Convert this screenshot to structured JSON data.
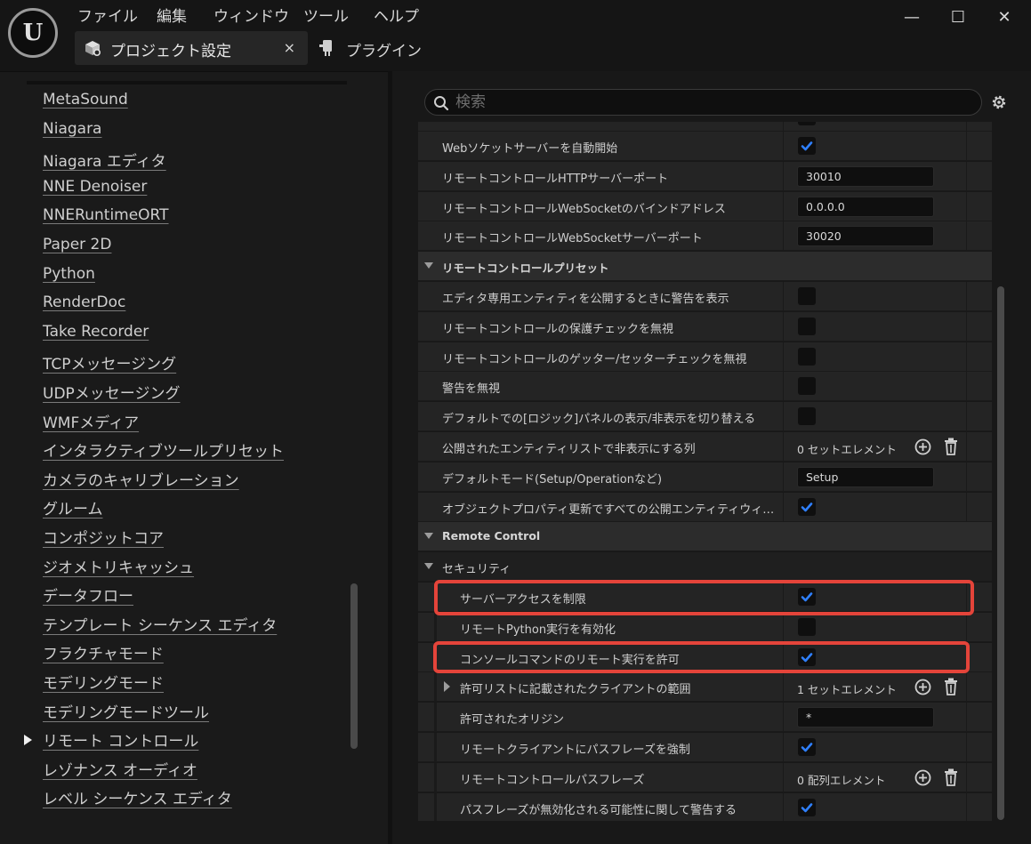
{
  "app": {
    "logo_text": "U",
    "menu": [
      "ファイル",
      "編集",
      "ウィンドウ",
      "ツール",
      "ヘルプ"
    ],
    "window_controls": {
      "minimize": "—",
      "maximize": "☐",
      "close": "✕"
    },
    "tabs": [
      {
        "label": "プロジェクト設定",
        "icon": "project-settings-icon",
        "active": true,
        "close": "×"
      },
      {
        "label": "プラグイン",
        "icon": "plugin-icon",
        "active": false
      }
    ]
  },
  "sidebar": {
    "items": [
      "MetaSound",
      "Niagara",
      "Niagara エディタ",
      "NNE Denoiser",
      "NNERuntimeORT",
      "Paper 2D",
      "Python",
      "RenderDoc",
      "Take Recorder",
      "TCPメッセージング",
      "UDPメッセージング",
      "WMFメディア",
      "インタラクティブツールプリセット",
      "カメラのキャリブレーション",
      "グルーム",
      "コンポジットコア",
      "ジオメトリキャッシュ",
      "データフロー",
      "テンプレート シーケンス エディタ",
      "フラクチャモード",
      "モデリングモード",
      "モデリングモードツール",
      "リモート コントロール",
      "レゾナンス オーディオ",
      "レベル シーケンス エディタ"
    ],
    "selected_index": 22
  },
  "search": {
    "placeholder": "検索"
  },
  "settings": {
    "rows": [
      {
        "type": "prop",
        "label": "Webソケットサーバーを自動開始",
        "value_type": "checkbox",
        "checked": true
      },
      {
        "type": "prop",
        "label": "リモートコントロールHTTPサーバーポート",
        "value_type": "text",
        "value": "30010"
      },
      {
        "type": "prop",
        "label": "リモートコントロールWebSocketのバインドアドレス",
        "value_type": "text",
        "value": "0.0.0.0"
      },
      {
        "type": "prop",
        "label": "リモートコントロールWebSocketサーバーポート",
        "value_type": "text",
        "value": "30020"
      },
      {
        "type": "header",
        "label": "リモートコントロールプリセット"
      },
      {
        "type": "prop",
        "label": "エディタ専用エンティティを公開するときに警告を表示",
        "value_type": "checkbox",
        "checked": false
      },
      {
        "type": "prop",
        "label": "リモートコントロールの保護チェックを無視",
        "value_type": "checkbox",
        "checked": false
      },
      {
        "type": "prop",
        "label": "リモートコントロールのゲッター/セッターチェックを無視",
        "value_type": "checkbox",
        "checked": false
      },
      {
        "type": "prop",
        "label": "警告を無視",
        "value_type": "checkbox",
        "checked": false
      },
      {
        "type": "prop",
        "label": "デフォルトでの[ロジック]パネルの表示/非表示を切り替える",
        "value_type": "checkbox",
        "checked": false
      },
      {
        "type": "prop",
        "label": "公開されたエンティティリストで非表示にする列",
        "value_type": "array",
        "value": "0 セットエレメント"
      },
      {
        "type": "prop",
        "label": "デフォルトモード(Setup/Operationなど)",
        "value_type": "text",
        "value": "Setup"
      },
      {
        "type": "prop",
        "label": "オブジェクトプロパティ更新ですべての公開エンティティウィジェットを更新",
        "value_type": "checkbox",
        "checked": true
      },
      {
        "type": "header",
        "label": "Remote Control"
      },
      {
        "type": "plain",
        "label": "セキュリティ"
      },
      {
        "type": "sub",
        "label": "サーバーアクセスを制限",
        "value_type": "checkbox",
        "checked": true
      },
      {
        "type": "sub",
        "label": "リモートPython実行を有効化",
        "value_type": "checkbox",
        "checked": false
      },
      {
        "type": "sub",
        "label": "コンソールコマンドのリモート実行を許可",
        "value_type": "checkbox",
        "checked": true
      },
      {
        "type": "sub",
        "label": "許可リストに記載されたクライアントの範囲",
        "value_type": "array",
        "value": "1 セットエレメント",
        "expandable": true
      },
      {
        "type": "sub",
        "label": "許可されたオリジン",
        "value_type": "text",
        "value": "*"
      },
      {
        "type": "sub",
        "label": "リモートクライアントにパスフレーズを強制",
        "value_type": "checkbox",
        "checked": true
      },
      {
        "type": "sub",
        "label": "リモートコントロールパスフレーズ",
        "value_type": "array",
        "value": "0 配列エレメント"
      },
      {
        "type": "sub",
        "label": "パスフレーズが無効化される可能性に関して警告する",
        "value_type": "checkbox",
        "checked": true
      }
    ]
  },
  "highlights": [
    "サーバーアクセスを制限",
    "コンソールコマンドのリモート実行を許可"
  ],
  "colors": {
    "accent_check": "#2f80ff",
    "highlight": "#e4443a",
    "panel": "#242424"
  }
}
